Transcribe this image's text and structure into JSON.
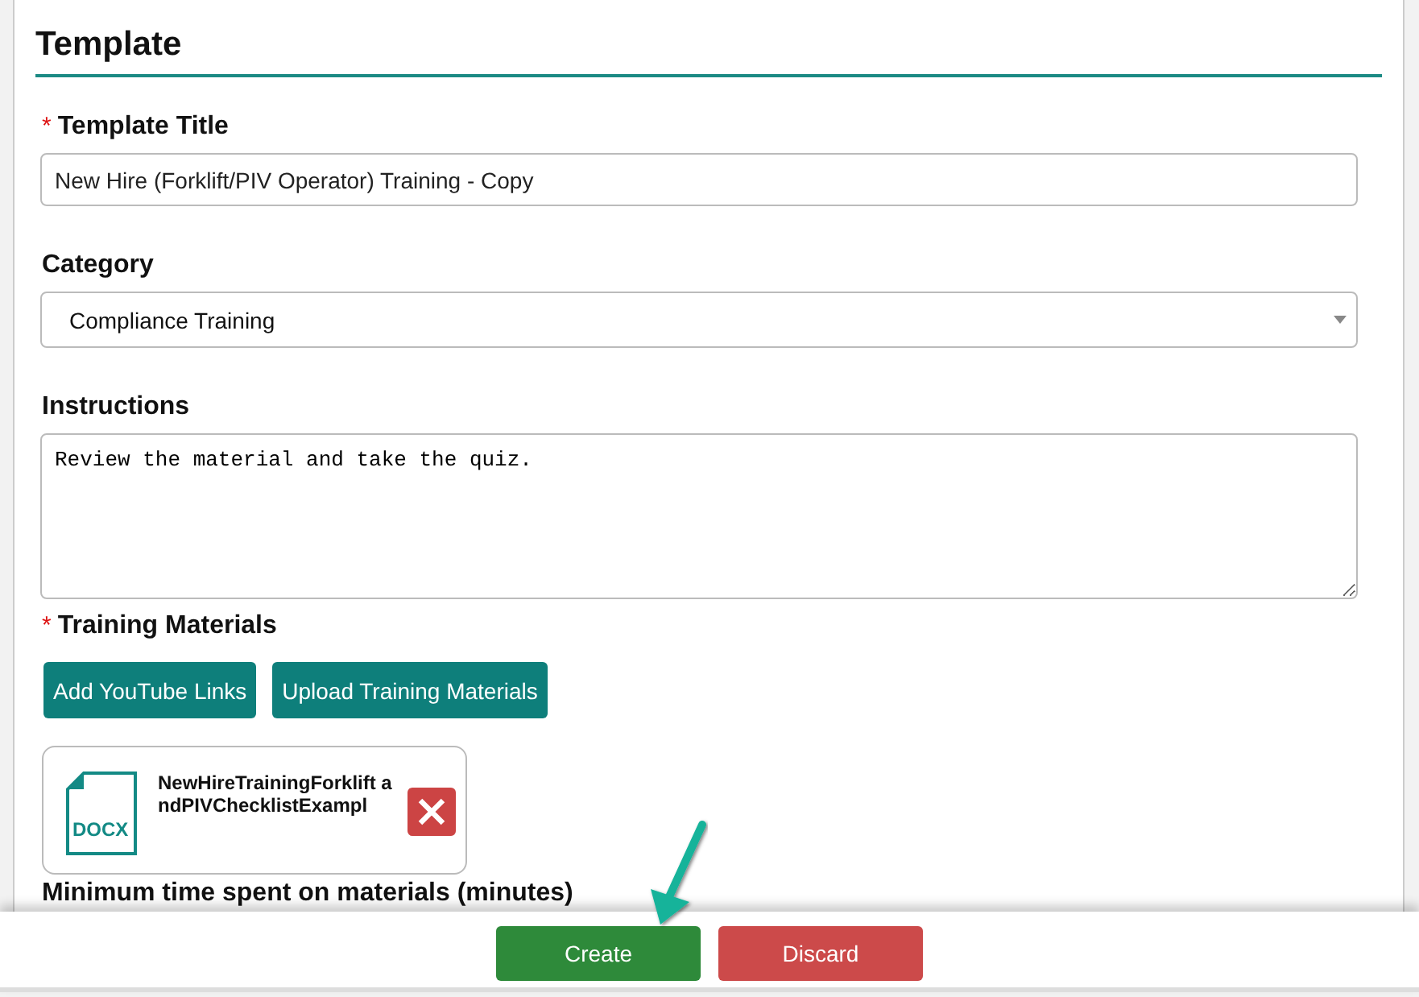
{
  "section": {
    "title": "Template"
  },
  "fields": [
    {
      "kind": "text",
      "marker": "*",
      "label": "Template Title",
      "value": "New Hire (Forklift/PIV Operator) Training - Copy"
    },
    {
      "kind": "select",
      "label": "Category",
      "value": "Compliance Training"
    },
    {
      "kind": "textarea",
      "label": "Instructions",
      "value": "Review the material and take the quiz."
    }
  ],
  "training_materials": {
    "marker": "*",
    "label": "Training Materials",
    "buttons": [
      "Add YouTube Links",
      "Upload Training Materials"
    ],
    "files": [
      {
        "type": "DOCX",
        "name": "NewHireTrainingForklift andPIVChecklistExampl"
      }
    ]
  },
  "minimum_time_label": "Minimum time spent on materials (minutes)",
  "footer": {
    "buttons": [
      {
        "label": "Create",
        "kind": "primary"
      },
      {
        "label": "Discard",
        "kind": "danger"
      }
    ]
  }
}
